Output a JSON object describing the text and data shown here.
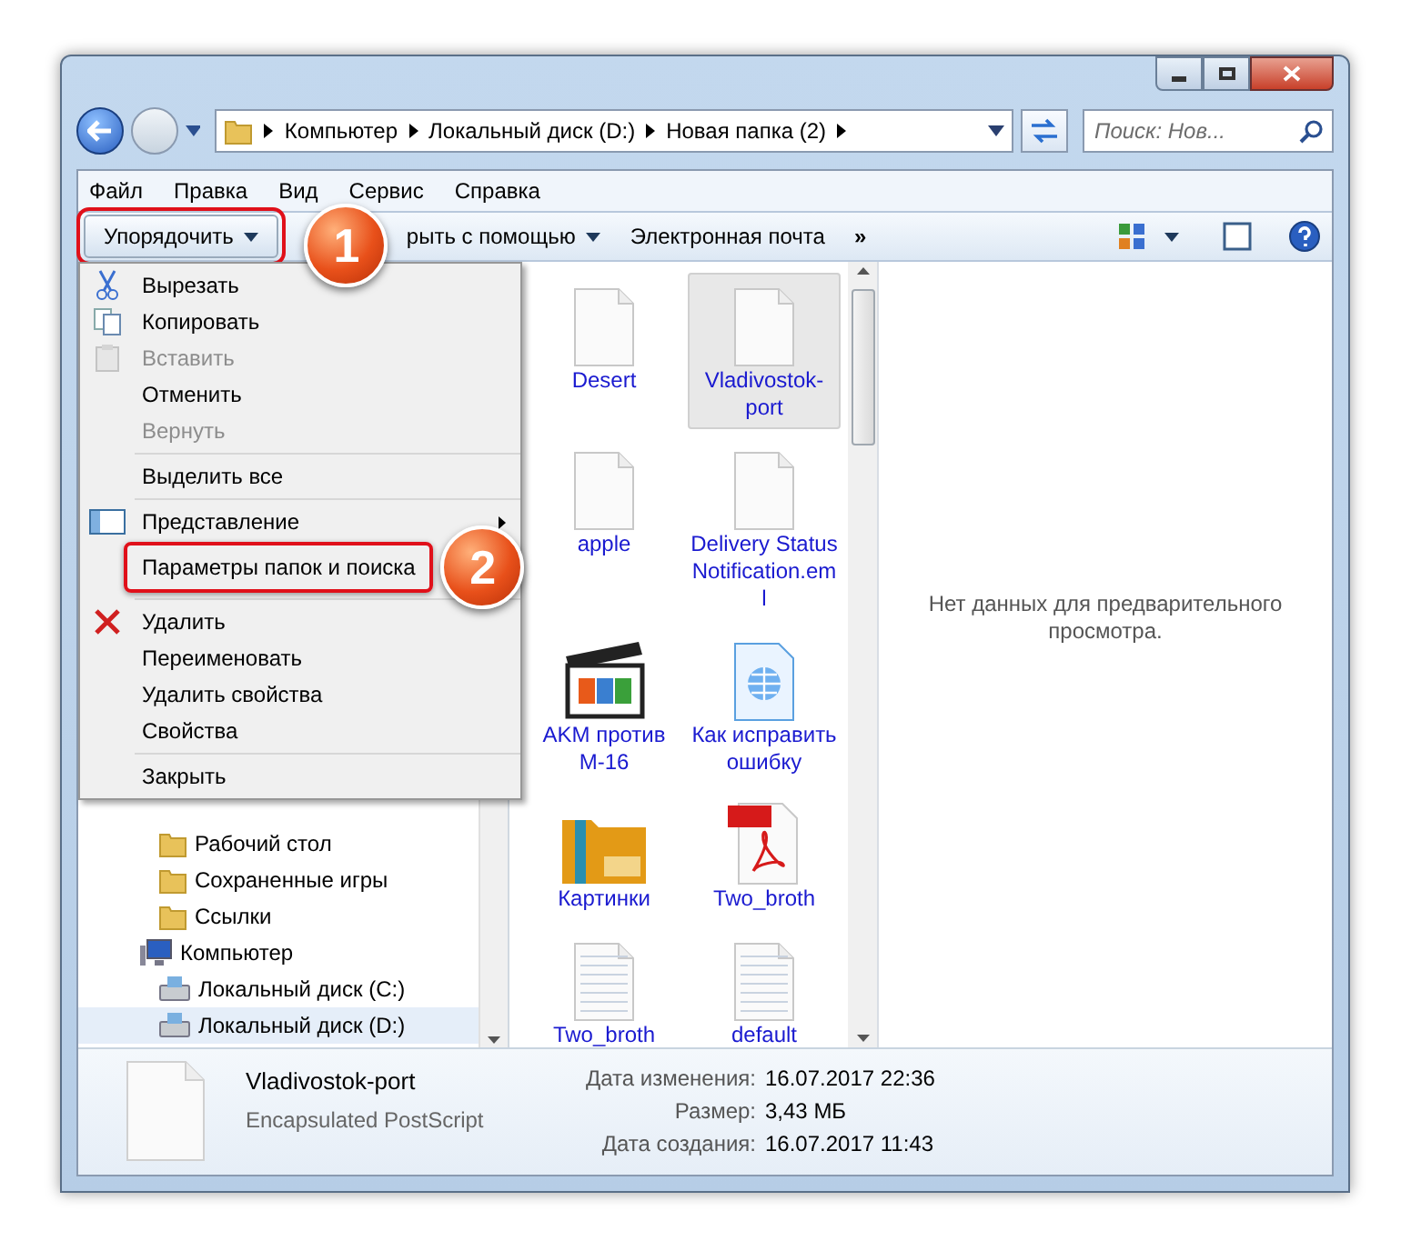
{
  "address_bar": {
    "crumbs": [
      "Компьютер",
      "Локальный диск (D:)",
      "Новая папка (2)"
    ]
  },
  "search": {
    "placeholder": "Поиск: Нов..."
  },
  "menu_bar": [
    "Файл",
    "Правка",
    "Вид",
    "Сервис",
    "Справка"
  ],
  "toolbar": {
    "organize": {
      "label": "Упорядочить",
      "callout": "1"
    },
    "buttons": [
      "рыть с помощью",
      "Электронная почта"
    ],
    "more": "»"
  },
  "organize_menu": {
    "groups": [
      [
        {
          "label": "Вырезать",
          "disabled": false
        },
        {
          "label": "Копировать",
          "disabled": false
        },
        {
          "label": "Вставить",
          "disabled": true
        },
        {
          "label": "Отменить",
          "disabled": false
        },
        {
          "label": "Вернуть",
          "disabled": true
        }
      ],
      [
        {
          "label": "Выделить все",
          "disabled": false
        }
      ],
      [
        {
          "label": "Представление",
          "disabled": false,
          "submenu": true
        },
        {
          "label": "Параметры папок и поиска",
          "disabled": false,
          "callout": "2"
        }
      ],
      [
        {
          "label": "Удалить",
          "disabled": false
        },
        {
          "label": "Переименовать",
          "disabled": false
        },
        {
          "label": "Удалить свойства",
          "disabled": false
        },
        {
          "label": "Свойства",
          "disabled": false
        }
      ],
      [
        {
          "label": "Закрыть",
          "disabled": false
        }
      ]
    ]
  },
  "sidebar": {
    "items": [
      {
        "label": "Рабочий стол",
        "selected": false
      },
      {
        "label": "Сохраненные игры",
        "selected": false
      },
      {
        "label": "Ссылки",
        "selected": false
      },
      {
        "label": "Компьютер",
        "selected": false,
        "children": [
          {
            "label": "Локальный диск (C:)",
            "selected": false
          },
          {
            "label": "Локальный диск (D:)",
            "selected": true
          }
        ]
      }
    ]
  },
  "files": [
    {
      "name": "Desert",
      "kind": "blank",
      "selected": false
    },
    {
      "name": "Vladivostok-port",
      "kind": "blank",
      "selected": true
    },
    {
      "name": "apple",
      "kind": "blank",
      "selected": false
    },
    {
      "name": "Delivery Status Notification.eml",
      "kind": "blank",
      "selected": false
    },
    {
      "name": "AKM против M-16",
      "kind": "video",
      "selected": false
    },
    {
      "name": "Как исправить ошибку",
      "kind": "web",
      "selected": false
    },
    {
      "name": "Картинки",
      "kind": "archive",
      "selected": false
    },
    {
      "name": "Two_broth",
      "kind": "pdf",
      "selected": false
    },
    {
      "name": "Two_broth",
      "kind": "text",
      "selected": false
    },
    {
      "name": "default",
      "kind": "text",
      "selected": false
    }
  ],
  "preview": {
    "message": "Нет данных для предварительного просмотра."
  },
  "details": {
    "name": "Vladivostok-port",
    "type": "Encapsulated PostScript",
    "fields": [
      {
        "label": "Дата изменения:",
        "value": "16.07.2017 22:36"
      },
      {
        "label": "Размер:",
        "value": "3,43 МБ"
      },
      {
        "label": "Дата создания:",
        "value": "16.07.2017 11:43"
      }
    ]
  }
}
